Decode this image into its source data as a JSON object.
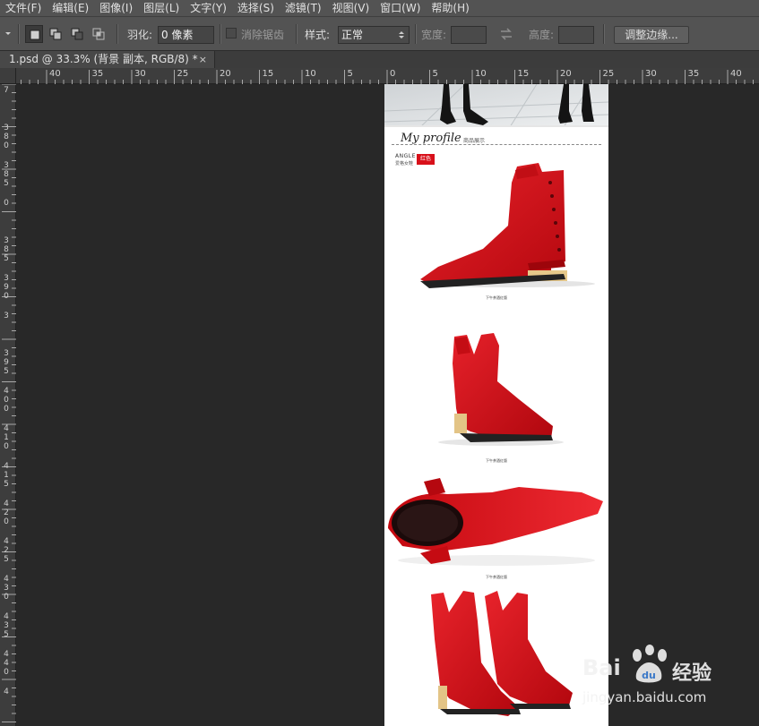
{
  "menu": [
    "文件(F)",
    "编辑(E)",
    "图像(I)",
    "图层(L)",
    "文字(Y)",
    "选择(S)",
    "滤镜(T)",
    "视图(V)",
    "窗口(W)",
    "帮助(H)"
  ],
  "options": {
    "feather_label": "羽化:",
    "feather_value": "0 像素",
    "antialias_label": "消除锯齿",
    "style_label": "样式:",
    "style_value": "正常",
    "width_label": "宽度:",
    "height_label": "高度:",
    "refine_edge_label": "调整边缘..."
  },
  "tab": {
    "title": "1.psd @ 33.3% (背景 副本, RGB/8) *",
    "close": "×"
  },
  "hruler": [
    "40",
    "35",
    "30",
    "25",
    "20",
    "15",
    "10",
    "5",
    "0",
    "5",
    "10",
    "15",
    "20",
    "25",
    "30",
    "35",
    "40"
  ],
  "vruler": [
    "7",
    "380",
    "385",
    "0",
    "385",
    "390",
    "3",
    "395",
    "400",
    "410",
    "415",
    "420",
    "425",
    "430",
    "435",
    "440",
    "4"
  ],
  "document": {
    "heading": "My profile",
    "heading_sub": "商品展示",
    "brand": "ANGLE",
    "brand_sub": "爱格女鞋",
    "badge": "红色",
    "captions": [
      "下午茶酒红版",
      "下午茶酒红版",
      "下午茶酒红版"
    ]
  },
  "watermark": {
    "brand_en": "Bai",
    "brand_cn": "经验",
    "url": "jingyan.baidu.com"
  },
  "colors": {
    "boot_red": "#d8101a",
    "ui_gray": "#535353",
    "canvas_bg": "#282828"
  }
}
